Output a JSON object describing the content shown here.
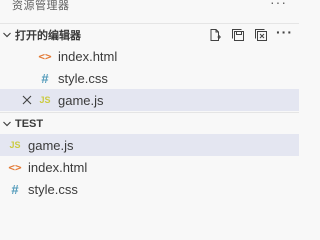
{
  "titlebar": {
    "title": "资源管理器",
    "more": "···"
  },
  "open_editors": {
    "header": "打开的编辑器",
    "more": "···",
    "actions": [
      {
        "name": "new-untitled-file-icon"
      },
      {
        "name": "save-all-icon"
      },
      {
        "name": "close-all-icon"
      }
    ],
    "items": [
      {
        "icon": "html-file-icon",
        "glyph": "<>",
        "label": "index.html"
      },
      {
        "icon": "css-file-icon",
        "glyph": "#",
        "label": "style.css"
      },
      {
        "icon": "js-file-icon",
        "glyph": "JS",
        "label": "game.js",
        "selected": true
      }
    ]
  },
  "workspace": {
    "header": "TEST",
    "items": [
      {
        "icon": "js-file-icon",
        "glyph": "JS",
        "label": "game.js",
        "selected": true
      },
      {
        "icon": "html-file-icon",
        "glyph": "<>",
        "label": "index.html"
      },
      {
        "icon": "css-file-icon",
        "glyph": "#",
        "label": "style.css"
      }
    ]
  },
  "colors": {
    "background": "#f8f8f8",
    "selected_row": "#e4e6f1",
    "html_icon": "#e37933",
    "css_icon": "#519aba",
    "js_icon": "#cbcb41"
  }
}
